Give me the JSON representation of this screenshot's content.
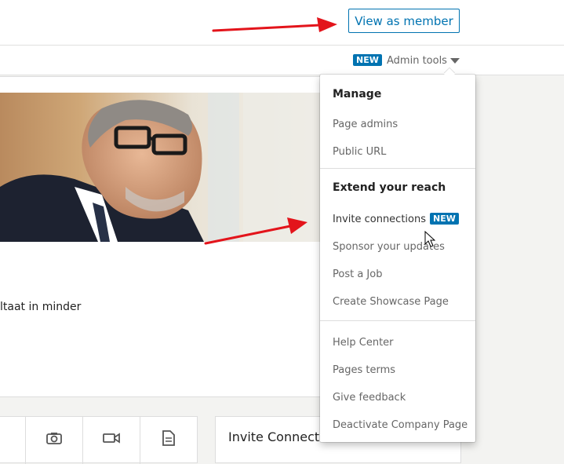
{
  "header": {
    "view_as_member": "View as member"
  },
  "admin_bar": {
    "badge": "NEW",
    "admin_tools": "Admin tools"
  },
  "hero": {
    "text": "ltaat in minder"
  },
  "dropdown": {
    "manage_heading": "Manage",
    "page_admins": "Page admins",
    "public_url": "Public URL",
    "extend_heading": "Extend your reach",
    "invite_connections": "Invite connections",
    "invite_badge": "NEW",
    "sponsor_updates": "Sponsor your updates",
    "post_job": "Post a Job",
    "create_showcase": "Create Showcase Page",
    "help_center": "Help Center",
    "pages_terms": "Pages terms",
    "give_feedback": "Give feedback",
    "deactivate": "Deactivate Company Page"
  },
  "invite_card": {
    "title": "Invite Connections To Follow"
  },
  "colors": {
    "accent": "#0073b1",
    "annotation_arrow": "#e3141b"
  },
  "icons": [
    "camera-icon",
    "video-icon",
    "document-icon",
    "mouse-cursor-icon"
  ]
}
